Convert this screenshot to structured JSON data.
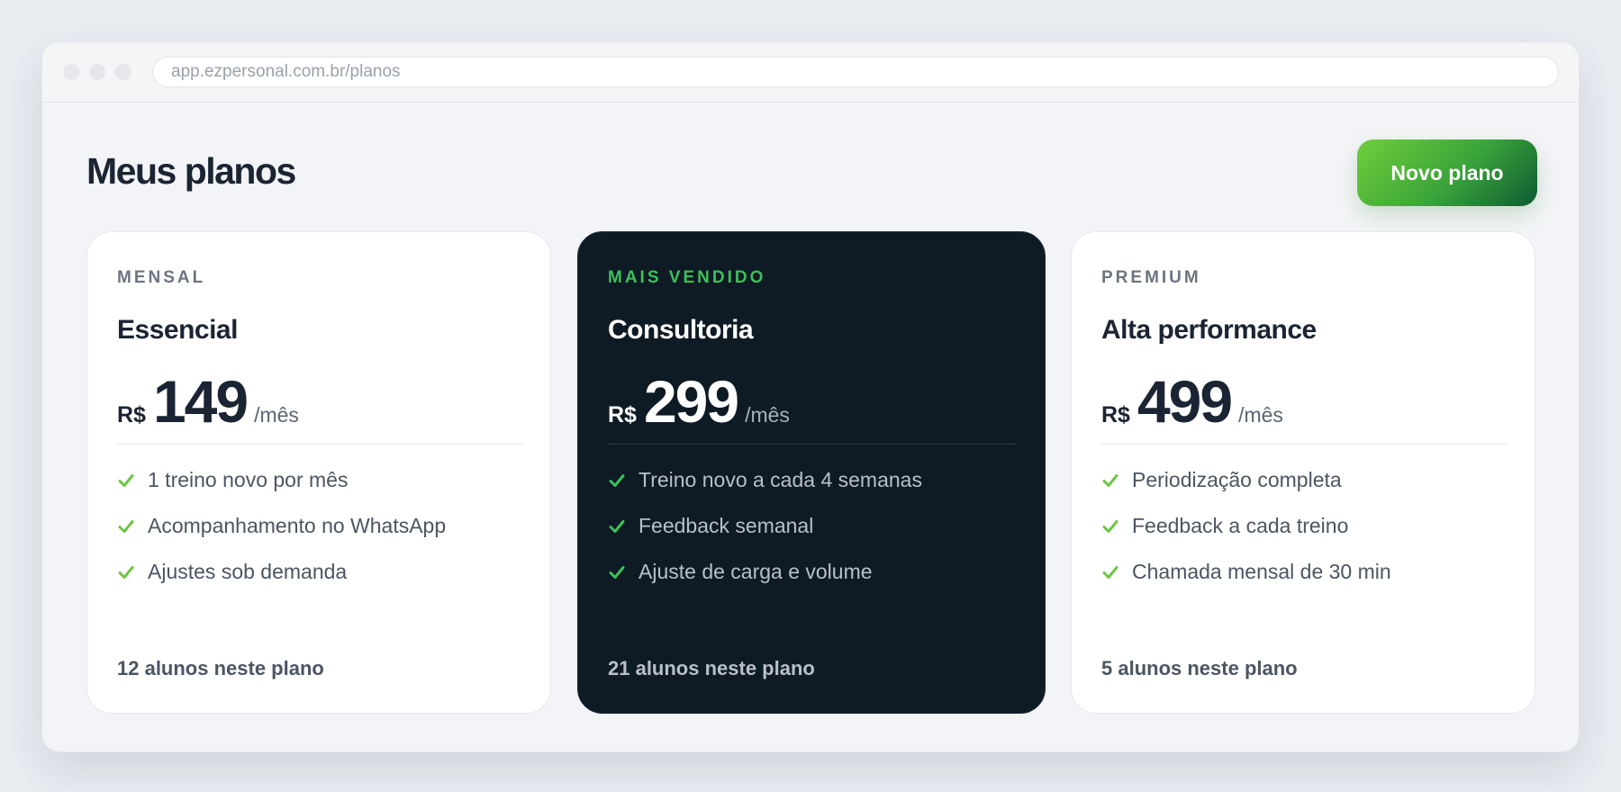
{
  "browser": {
    "url": "app.ezpersonal.com.br/planos"
  },
  "header": {
    "title": "Meus planos",
    "new_plan_label": "Novo plano"
  },
  "colors": {
    "accent_green": "#3cc05a",
    "check_green": "#6cc644",
    "dark_card": "#0e1a24",
    "text_dark": "#1b2433"
  },
  "plans": [
    {
      "tier": "MENSAL",
      "name": "Essencial",
      "currency": "R$",
      "price": "149",
      "period": "/mês",
      "features": [
        "1 treino novo por mês",
        "Acompanhamento no WhatsApp",
        "Ajustes sob demanda"
      ],
      "students": "12 alunos neste plano"
    },
    {
      "tier": "MAIS VENDIDO",
      "name": "Consultoria",
      "currency": "R$",
      "price": "299",
      "period": "/mês",
      "features": [
        "Treino novo a cada 4 semanas",
        "Feedback semanal",
        "Ajuste de carga e volume"
      ],
      "students": "21 alunos neste plano"
    },
    {
      "tier": "PREMIUM",
      "name": "Alta performance",
      "currency": "R$",
      "price": "499",
      "period": "/mês",
      "features": [
        "Periodização completa",
        "Feedback a cada treino",
        "Chamada mensal de 30 min"
      ],
      "students": "5 alunos neste plano"
    }
  ],
  "icons": {
    "feature": "check-icon"
  }
}
